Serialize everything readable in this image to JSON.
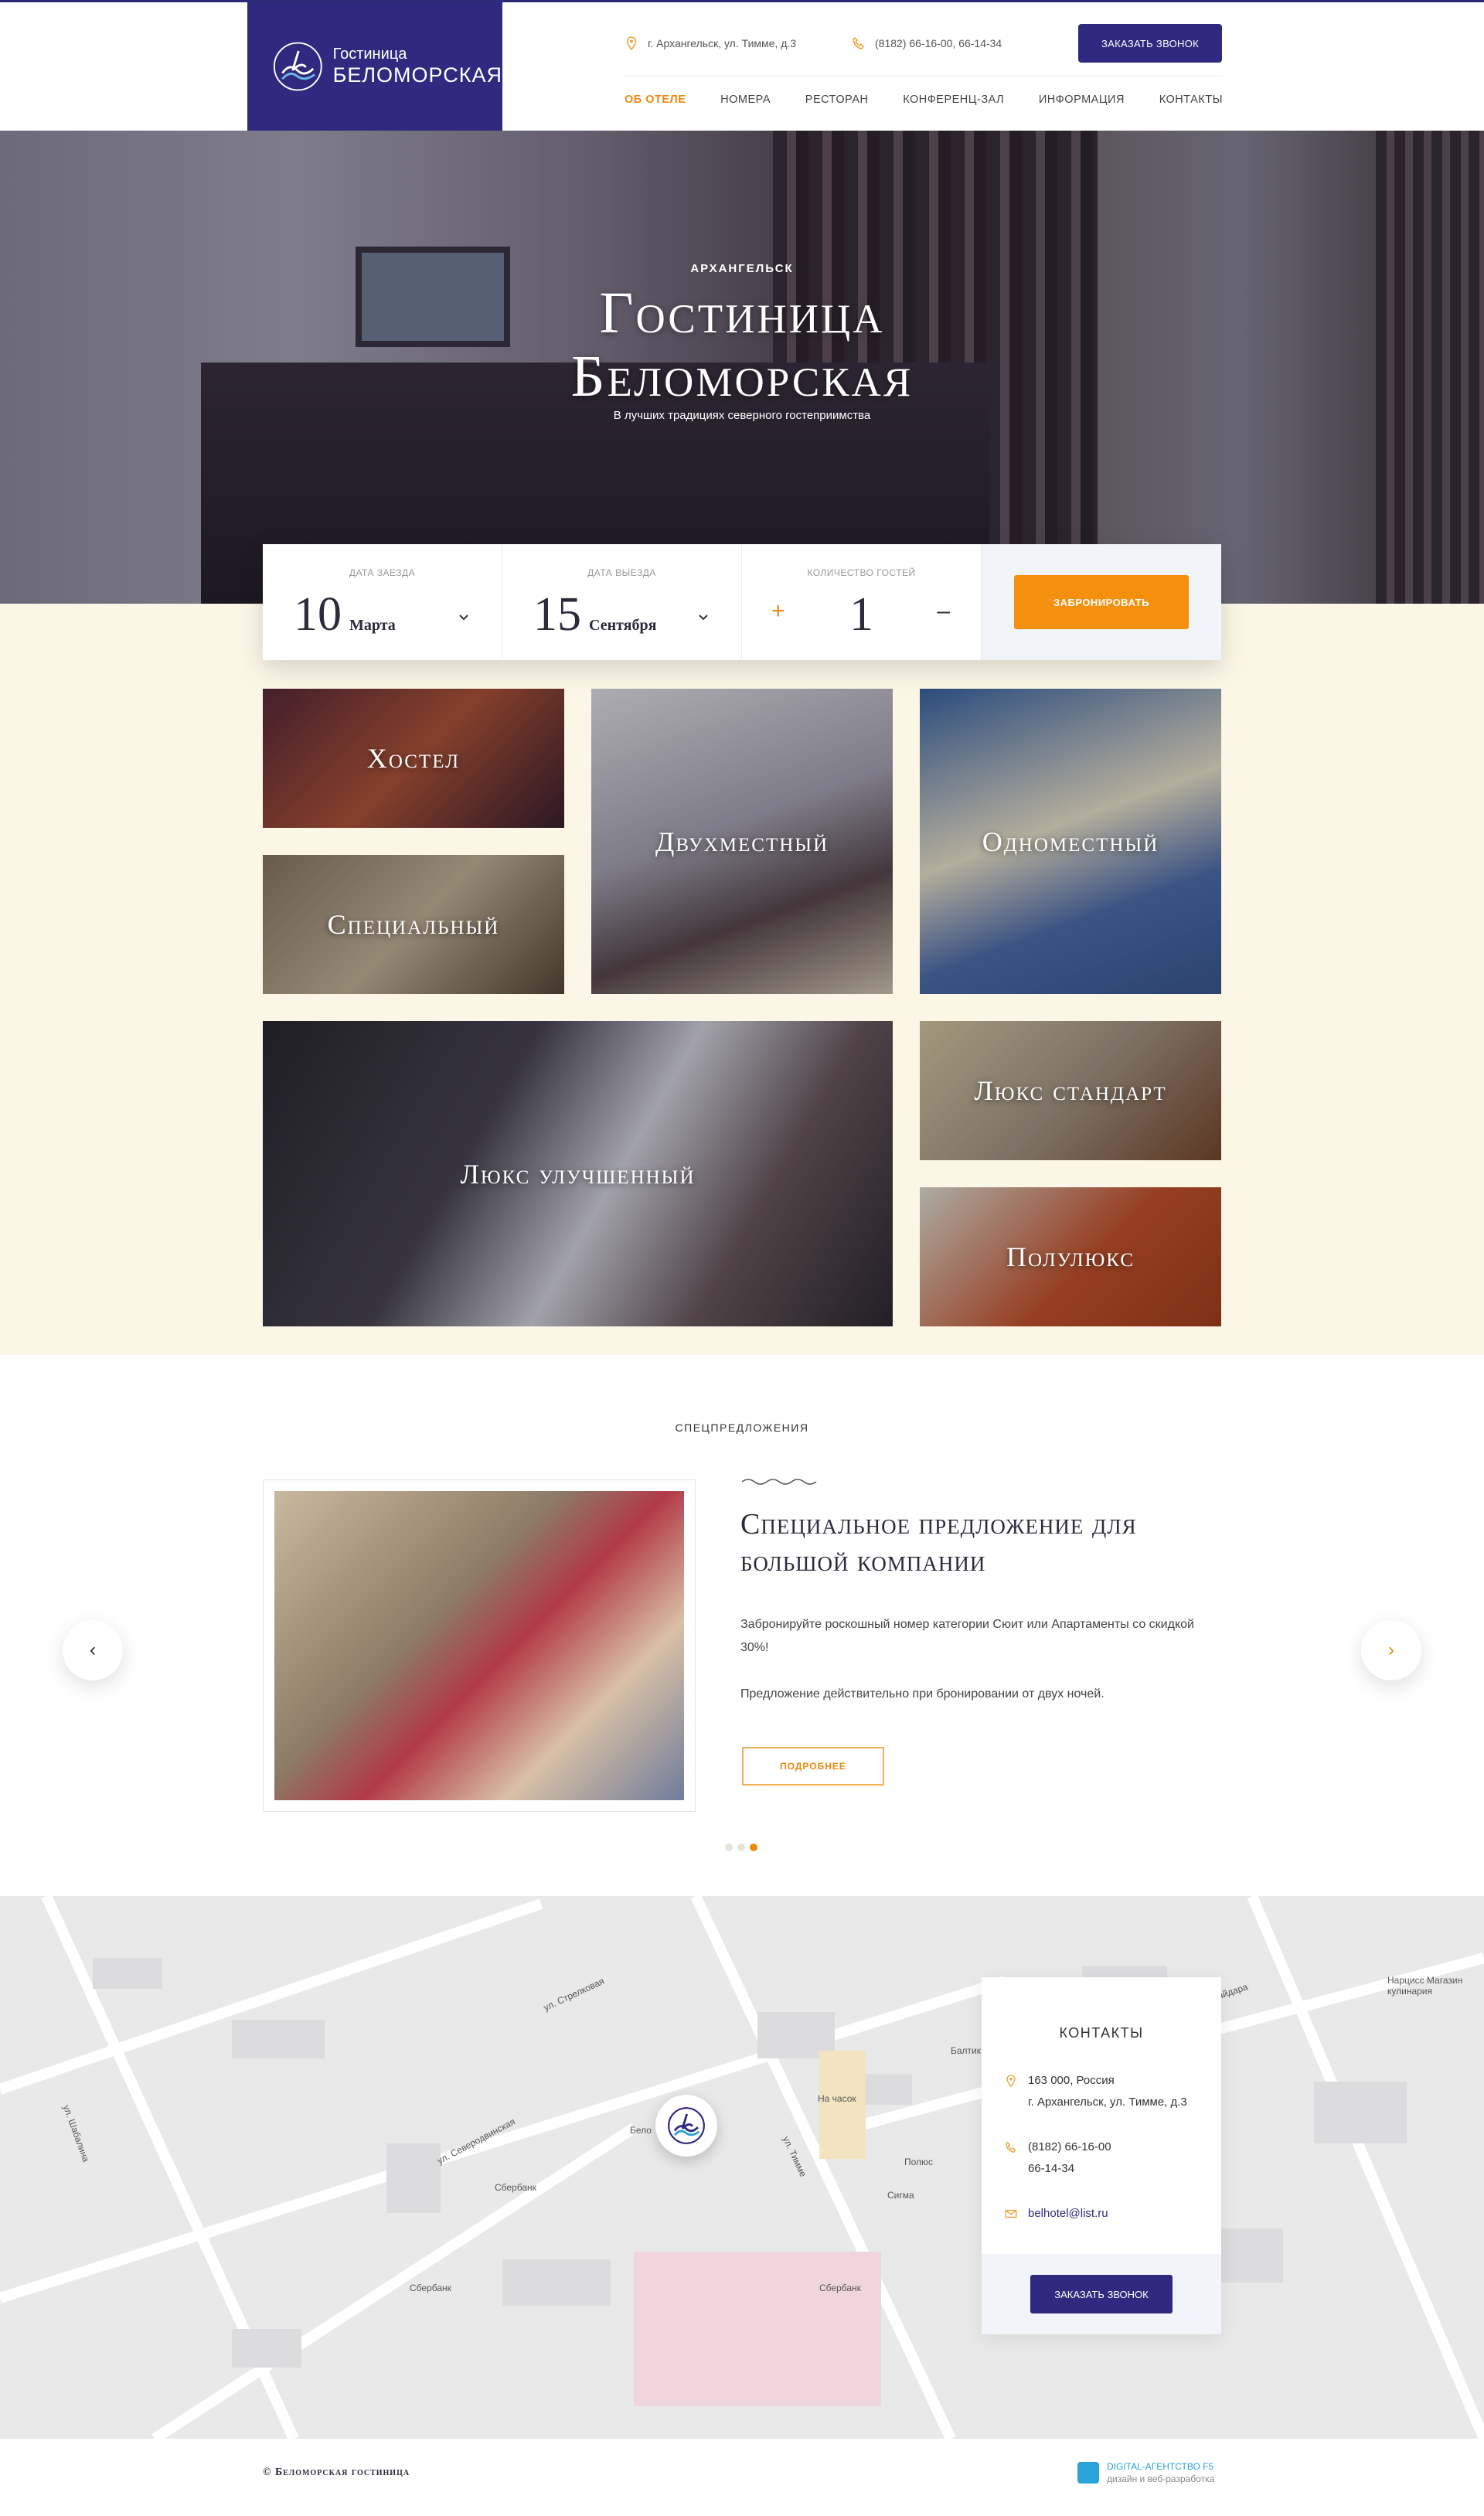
{
  "header": {
    "logo_small": "Гостиница",
    "logo_big": "БЕЛОМОРСКАЯ",
    "address": "г. Архангельск, ул. Тимме, д.3",
    "phone": "(8182) 66-16-00, 66-14-34",
    "call_button": "ЗАКАЗАТЬ ЗВОНОК",
    "nav": [
      "ОБ ОТЕЛЕ",
      "НОМЕРА",
      "РЕСТОРАН",
      "КОНФЕРЕНЦ-ЗАЛ",
      "ИНФОРМАЦИЯ",
      "КОНТАКТЫ"
    ]
  },
  "hero": {
    "city": "АРХАНГЕЛЬСК",
    "title_line1": "Гостиница",
    "title_line2": "Беломорская",
    "subtitle": "В лучших традициях северного гостеприимства"
  },
  "booking": {
    "checkin_label": "ДАТА ЗАЕЗДА",
    "checkin_day": "10",
    "checkin_month": "Марта",
    "checkout_label": "ДАТА ВЫЕЗДА",
    "checkout_day": "15",
    "checkout_month": "Сентября",
    "guests_label": "КОЛИЧЕСТВО ГОСТЕЙ",
    "guests_plus": "+",
    "guests_count": "1",
    "guests_minus": "–",
    "book_button": "ЗАБРОНИРОВАТЬ"
  },
  "rooms": [
    "Хостел",
    "Двухместный",
    "Одноместный",
    "Специальный",
    "Люкс улучшенный",
    "Люкс стандарт",
    "Полулюкс"
  ],
  "offers": {
    "section_label": "СПЕЦПРЕДЛОЖЕНИЯ",
    "title": "Специальное предложение для большой компании",
    "p1": "Забронируйте роскошный номер категории Сюит или Апартаменты  со скидкой 30%!",
    "p2": "Предложение действительно при бронировании от двух ночей.",
    "more_button": "ПОДРОБНЕЕ",
    "prev": "‹",
    "next": "›",
    "slides": 3,
    "active_slide": 3
  },
  "map": {
    "labels": [
      "Сбербанк",
      "Сбербанк",
      "Сбербанк",
      "На часок",
      "Полюс",
      "Сигма",
      "Балтик",
      "Нарцисс Магазин кулинария",
      "Бело"
    ],
    "streets": [
      "ул. Тимме",
      "ул. Северодвинская",
      "ул. Шабалина",
      "ул. Стрелковая",
      "ул. Гайдара"
    ]
  },
  "contacts": {
    "title": "КОНТАКТЫ",
    "address_line1": "163 000, Россия",
    "address_line2": "г. Архангельск, ул. Тимме, д.3",
    "phone_line1": "(8182) 66-16-00",
    "phone_line2": "66-14-34",
    "email": "belhotel@list.ru",
    "call_button": "ЗАКАЗАТЬ ЗВОНОК"
  },
  "footer": {
    "copyright": "© Беломорская гостиница",
    "dev_name": "DIGITAL-АГЕНТСТВО F5",
    "dev_sub": "дизайн и веб-разработка"
  },
  "colors": {
    "brand": "#2f2a80",
    "accent": "#f5900f",
    "cream": "#fbf6e6"
  }
}
